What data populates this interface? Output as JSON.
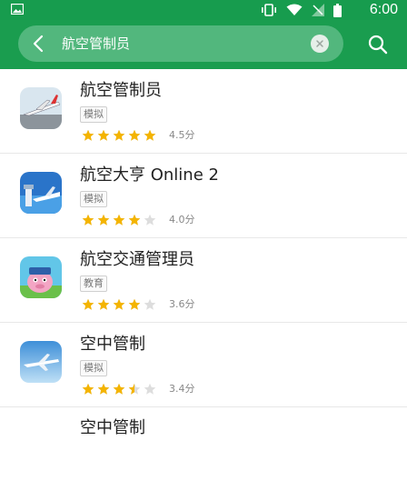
{
  "status_bar": {
    "time": "6:00",
    "icons": [
      "image-icon",
      "vibrate-icon",
      "wifi-icon",
      "signal-off-icon",
      "battery-icon"
    ]
  },
  "search": {
    "query": "航空管制员",
    "back_icon": "chevron-left-icon",
    "clear_icon": "clear-x-icon",
    "search_icon": "search-icon"
  },
  "colors": {
    "primary": "#1a9d4f",
    "search_bg": "#52b77d",
    "star_on": "#f4b400",
    "star_off": "#dddddd"
  },
  "results": [
    {
      "name": "航空管制员",
      "tag": "模拟",
      "stars": 5,
      "rating": "4.5分"
    },
    {
      "name": "航空大亨 Online 2",
      "tag": "模拟",
      "stars": 4,
      "rating": "4.0分"
    },
    {
      "name": "航空交通管理员",
      "tag": "教育",
      "stars": 4,
      "rating": "3.6分"
    },
    {
      "name": "空中管制",
      "tag": "模拟",
      "stars": 3.5,
      "rating": "3.4分"
    }
  ],
  "partial_item": {
    "name": "空中管制"
  }
}
